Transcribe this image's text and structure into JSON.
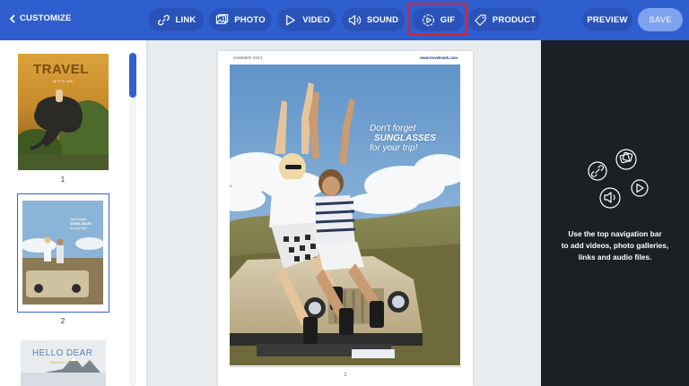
{
  "topbar": {
    "back_label": "CUSTOMIZE",
    "tools": [
      {
        "label": "LINK",
        "icon": "link-icon"
      },
      {
        "label": "PHOTO",
        "icon": "photo-icon"
      },
      {
        "label": "VIDEO",
        "icon": "play-icon"
      },
      {
        "label": "SOUND",
        "icon": "speaker-icon"
      },
      {
        "label": "GIF",
        "icon": "gif-icon"
      },
      {
        "label": "PRODUCT",
        "icon": "tag-icon"
      }
    ],
    "preview_label": "PREVIEW",
    "save_label": "SAVE",
    "colors": {
      "bar": "#2f5fcf",
      "pill": "#2a53b9",
      "highlight": "#e0202e",
      "save_disabled": "#7fa2ee"
    }
  },
  "thumbnails": [
    {
      "page": "1",
      "title": "TRAVEL",
      "subtitle": "WITH ME"
    },
    {
      "page": "2",
      "caption_lines": [
        "Don't forget",
        "SUNGLASSES",
        "for your trip!"
      ]
    },
    {
      "page": "",
      "title": "HELLO DEAR",
      "subtitle": "TRAVELLERS"
    }
  ],
  "page": {
    "header_left": "SUMMER 2023",
    "header_right": "www.travelmark.com",
    "caption": {
      "line1": "Don't forget",
      "line2": "SUNGLASSES",
      "line3": "for your trip!"
    },
    "footer_number": "2"
  },
  "right_panel": {
    "hint_lines": [
      "Use the top navigation bar",
      "to add videos, photo galleries,",
      "links and audio files."
    ],
    "icons": [
      "link-icon",
      "photo-icon",
      "speaker-icon",
      "play-icon"
    ]
  }
}
